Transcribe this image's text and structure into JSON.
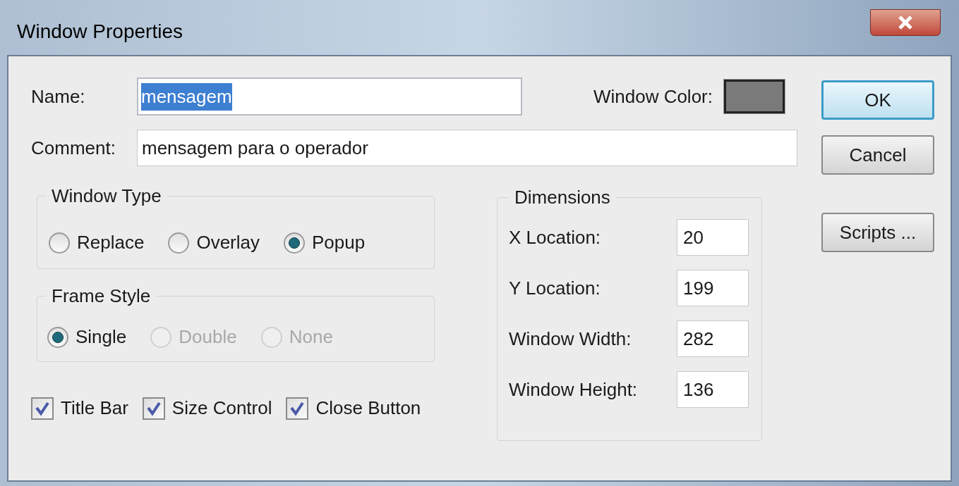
{
  "window": {
    "title": "Window Properties"
  },
  "name_field": {
    "label": "Name:",
    "value": "mensagem",
    "text_selected": true
  },
  "window_color": {
    "label": "Window Color:",
    "color": "#7a7a7a"
  },
  "comment_field": {
    "label": "Comment:",
    "value": "mensagem para o operador"
  },
  "window_type": {
    "title": "Window Type",
    "options": [
      {
        "label": "Replace",
        "selected": false,
        "disabled": false
      },
      {
        "label": "Overlay",
        "selected": false,
        "disabled": false
      },
      {
        "label": "Popup",
        "selected": true,
        "disabled": false
      }
    ]
  },
  "frame_style": {
    "title": "Frame Style",
    "options": [
      {
        "label": "Single",
        "selected": true,
        "disabled": false
      },
      {
        "label": "Double",
        "selected": false,
        "disabled": true
      },
      {
        "label": "None",
        "selected": false,
        "disabled": true
      }
    ]
  },
  "checkboxes": [
    {
      "label": "Title Bar",
      "checked": true
    },
    {
      "label": "Size Control",
      "checked": true
    },
    {
      "label": "Close Button",
      "checked": true
    }
  ],
  "dimensions": {
    "title": "Dimensions",
    "fields": [
      {
        "label": "X Location:",
        "value": "20"
      },
      {
        "label": "Y Location:",
        "value": "199"
      },
      {
        "label": "Window Width:",
        "value": "282"
      },
      {
        "label": "Window Height:",
        "value": "136"
      }
    ]
  },
  "buttons": [
    {
      "label": "OK",
      "default": true
    },
    {
      "label": "Cancel",
      "default": false
    },
    {
      "label": "Scripts ...",
      "default": false
    }
  ]
}
